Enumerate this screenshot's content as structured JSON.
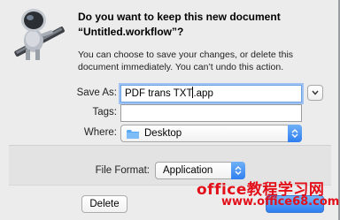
{
  "dialog": {
    "title": "Do you want to keep this new document “Untitled.workflow”?",
    "message": "You can choose to save your changes, or delete this document immediately. You can’t undo this action."
  },
  "form": {
    "save_as_label": "Save As:",
    "save_as_value": "PDF trans  TXT",
    "save_as_value_tail": ".app",
    "tags_label": "Tags:",
    "tags_value": "",
    "where_label": "Where:",
    "where_value": "Desktop",
    "file_format_label": "File Format:",
    "file_format_value": "Application"
  },
  "buttons": {
    "delete_label": "Delete"
  },
  "watermark": {
    "text": "office教程学习网",
    "url": "www.office68.com"
  },
  "icons": {
    "app_icon": "automator-robot-icon",
    "expand": "chevron-down-icon",
    "folder": "folder-icon",
    "stepper": "up-down-stepper-icon"
  },
  "colors": {
    "accent": "#2e7ef2",
    "focus_ring": "#9ec3f2",
    "watermark": "#e3101a"
  }
}
